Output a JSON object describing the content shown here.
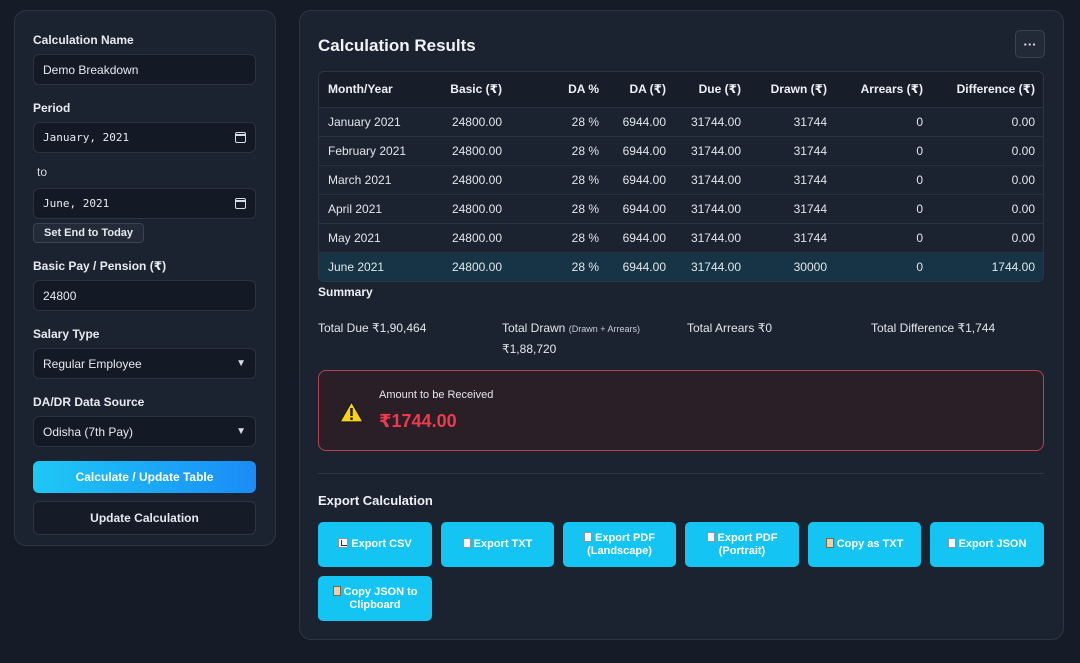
{
  "form": {
    "calc_name_label": "Calculation Name",
    "calc_name_value": "Demo Breakdown",
    "period_label": "Period",
    "period_start": "January, 2021",
    "to_label": "to",
    "period_end": "June, 2021",
    "set_end_today": "Set End to Today",
    "basic_pay_label": "Basic Pay / Pension (₹)",
    "basic_pay_value": "24800",
    "salary_type_label": "Salary Type",
    "salary_type_value": "Regular Employee",
    "da_source_label": "DA/DR Data Source",
    "da_source_value": "Odisha (7th Pay)",
    "calculate_btn": "Calculate / Update Table",
    "update_btn": "Update Calculation"
  },
  "results": {
    "title": "Calculation Results",
    "more_label": "···",
    "columns": [
      "Month/Year",
      "Basic (₹)",
      "DA %",
      "DA (₹)",
      "Due (₹)",
      "Drawn (₹)",
      "Arrears (₹)",
      "Difference (₹)"
    ],
    "rows": [
      [
        "January 2021",
        "24800.00",
        "28 %",
        "6944.00",
        "31744.00",
        "31744",
        "0",
        "0.00"
      ],
      [
        "February 2021",
        "24800.00",
        "28 %",
        "6944.00",
        "31744.00",
        "31744",
        "0",
        "0.00"
      ],
      [
        "March 2021",
        "24800.00",
        "28 %",
        "6944.00",
        "31744.00",
        "31744",
        "0",
        "0.00"
      ],
      [
        "April 2021",
        "24800.00",
        "28 %",
        "6944.00",
        "31744.00",
        "31744",
        "0",
        "0.00"
      ],
      [
        "May 2021",
        "24800.00",
        "28 %",
        "6944.00",
        "31744.00",
        "31744",
        "0",
        "0.00"
      ],
      [
        "June 2021",
        "24800.00",
        "28 %",
        "6944.00",
        "31744.00",
        "30000",
        "0",
        "1744.00"
      ]
    ]
  },
  "summary": {
    "title": "Summary",
    "total_due": "Total Due ₹1,90,464",
    "total_drawn_label": "Total Drawn",
    "total_drawn_note": "(Drawn + Arrears)",
    "total_drawn_value": "₹1,88,720",
    "total_arrears": "Total Arrears ₹0",
    "total_difference": "Total Difference ₹1,744"
  },
  "alert": {
    "label": "Amount to be Received",
    "amount": "₹1744.00",
    "icon": "warning-icon",
    "color": "#ef3a4e"
  },
  "export": {
    "title": "Export Calculation",
    "csv": "Export CSV",
    "txt": "Export TXT",
    "pdf_landscape_1": "Export PDF",
    "pdf_landscape_2": "(Landscape)",
    "pdf_portrait_1": "Export PDF",
    "pdf_portrait_2": "(Portrait)",
    "copy_txt": "Copy as TXT",
    "json": "Export JSON",
    "copy_json_1": "Copy JSON to",
    "copy_json_2": "Clipboard"
  }
}
